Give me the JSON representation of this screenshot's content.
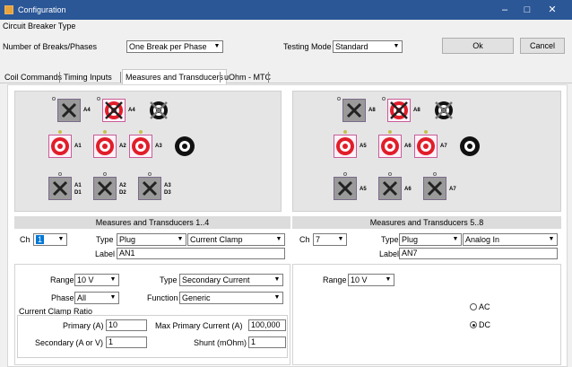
{
  "window": {
    "title": "Configuration",
    "minimize": "–",
    "maximize": "□",
    "close": "✕",
    "accent": "#2b5797"
  },
  "header": {
    "group_label": "Circuit Breaker Type",
    "breaks_label": "Number of Breaks/Phases",
    "breaks_value": "One Break per Phase",
    "testing_mode_label": "Testing Mode",
    "testing_mode_value": "Standard",
    "ok_label": "Ok",
    "cancel_label": "Cancel"
  },
  "tabs": [
    {
      "label": "Coil Commands",
      "active": false
    },
    {
      "label": "Timing Inputs",
      "active": false
    },
    {
      "label": "Measures and Transducers",
      "active": true
    },
    {
      "label": "uOhm - MTC",
      "active": false
    }
  ],
  "diagram_left": {
    "top_row": [
      "A4",
      "A4"
    ],
    "mid_row": [
      "A1",
      "A2",
      "A3"
    ],
    "bot_row": [
      [
        "A1",
        "D1"
      ],
      [
        "A2",
        "D2"
      ],
      [
        "A3",
        "D3"
      ]
    ]
  },
  "diagram_right": {
    "top_row": [
      "A8",
      "A8"
    ],
    "mid_row": [
      "A5",
      "A6",
      "A7"
    ],
    "bot_row": [
      [
        "A5"
      ],
      [
        "A6"
      ],
      [
        "A7"
      ]
    ]
  },
  "left_section": {
    "title": "Measures and Transducers 1..4",
    "ch_label": "Ch",
    "ch_value": "1",
    "type_label": "Type",
    "type_value": "Plug",
    "type2_value": "Current Clamp",
    "label_label": "Label",
    "label_value": "AN1",
    "range_label": "Range",
    "range_value": "10 V",
    "sig_type_label": "Type",
    "sig_type_value": "Secondary Current",
    "phase_label": "Phase",
    "phase_value": "All",
    "function_label": "Function",
    "function_value": "Generic",
    "clamp_group_label": "Current Clamp Ratio",
    "primary_label": "Primary (A)",
    "primary_value": "10",
    "max_primary_label": "Max Primary Current (A)",
    "max_primary_value": "100,000",
    "secondary_label": "Secondary (A or V)",
    "secondary_value": "1",
    "shunt_label": "Shunt (mOhm)",
    "shunt_value": "1"
  },
  "right_section": {
    "title": "Measures and Transducers 5..8",
    "ch_label": "Ch",
    "ch_value": "7",
    "type_label": "Type",
    "type_value": "Plug",
    "type2_value": "Analog In",
    "label_label": "Label",
    "label_value": "AN7",
    "range_label": "Range",
    "range_value": "10 V",
    "ac_label": "AC",
    "dc_label": "DC",
    "coupling_selected": "DC"
  }
}
